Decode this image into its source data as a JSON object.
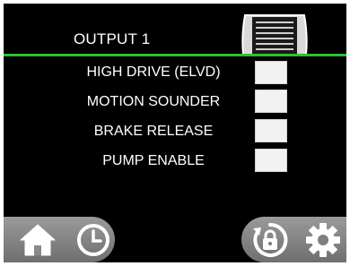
{
  "header": {
    "title": "OUTPUT 1",
    "accent_color": "#29c22f"
  },
  "outputs": [
    {
      "label": "HIGH DRIVE (ELVD)",
      "checked": false
    },
    {
      "label": "MOTION SOUNDER",
      "checked": false
    },
    {
      "label": "BRAKE RELEASE",
      "checked": false
    },
    {
      "label": "PUMP ENABLE",
      "checked": false
    }
  ],
  "bottom_bar": {
    "left": [
      "home-icon",
      "clock-icon"
    ],
    "right": [
      "rotate-lock-icon",
      "gear-icon"
    ]
  }
}
